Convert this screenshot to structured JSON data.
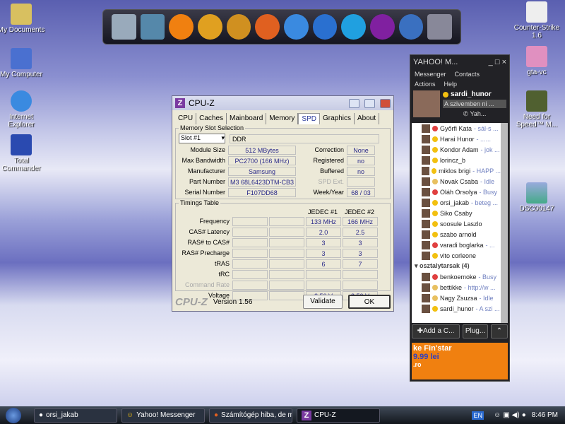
{
  "desktop": {
    "left_icons": [
      "My Documents",
      "My Computer",
      "Internet Explorer",
      "Total Commander"
    ],
    "right_icons": [
      "Counter-Strike 1.6",
      "gta-vc",
      "Need for Speed™ M...",
      "DSC00147"
    ]
  },
  "dock": {
    "icons": [
      "computer-icon",
      "network-icon",
      "winamp-icon",
      "vlc-icon",
      "winamp-bolt-icon",
      "firefox-icon",
      "internet-explorer-icon",
      "media-player-icon",
      "skype-icon",
      "yahoo-messenger-icon",
      "windows-icon",
      "recycle-bin-icon"
    ]
  },
  "cpuz": {
    "title": "CPU-Z",
    "tabs": [
      "CPU",
      "Caches",
      "Mainboard",
      "Memory",
      "SPD",
      "Graphics",
      "About"
    ],
    "active_tab": "SPD",
    "slot_group": "Memory Slot Selection",
    "slot": "Slot #1",
    "type": "DDR",
    "fields": [
      {
        "label": "Module Size",
        "value": "512 MBytes"
      },
      {
        "label": "Max Bandwidth",
        "value": "PC2700 (166 MHz)"
      },
      {
        "label": "Manufacturer",
        "value": "Samsung"
      },
      {
        "label": "Part Number",
        "value": "M3 68L6423DTM-CB3"
      },
      {
        "label": "Serial Number",
        "value": "F107DD68"
      }
    ],
    "right_fields": [
      {
        "label": "Correction",
        "value": "None"
      },
      {
        "label": "Registered",
        "value": "no"
      },
      {
        "label": "Buffered",
        "value": "no"
      },
      {
        "label": "SPD Ext.",
        "value": ""
      },
      {
        "label": "Week/Year",
        "value": "68 / 03"
      }
    ],
    "timings_group": "Timings Table",
    "col_headers": [
      "JEDEC #1",
      "JEDEC #2"
    ],
    "timings": [
      {
        "label": "Frequency",
        "j1": "133 MHz",
        "j2": "166 MHz"
      },
      {
        "label": "CAS# Latency",
        "j1": "2.0",
        "j2": "2.5"
      },
      {
        "label": "RAS# to CAS#",
        "j1": "3",
        "j2": "3"
      },
      {
        "label": "RAS# Precharge",
        "j1": "3",
        "j2": "3"
      },
      {
        "label": "tRAS",
        "j1": "6",
        "j2": "7"
      },
      {
        "label": "tRC",
        "j1": "",
        "j2": ""
      },
      {
        "label": "Command Rate",
        "j1": "",
        "j2": ""
      },
      {
        "label": "Voltage",
        "j1": "2.50 V",
        "j2": "2.50 V"
      }
    ],
    "brand": "CPU-Z",
    "version": "Version 1.56",
    "validate": "Validate",
    "ok": "OK"
  },
  "yahoo": {
    "title": "YAHOO! M...",
    "menu": [
      "Messenger",
      "Contacts",
      "Actions",
      "Help"
    ],
    "user": "sardi_hunor",
    "status": "A szivemben ni ...",
    "yah": "Yah...",
    "contacts": [
      {
        "name": "Győrfi Kata",
        "sub": " - sál-s ...",
        "s": "busy"
      },
      {
        "name": "Harai Hunor",
        "sub": " - ......",
        "s": "on"
      },
      {
        "name": "Kondor Adam",
        "sub": " - jok ...",
        "s": "on"
      },
      {
        "name": "lorincz_b",
        "sub": "",
        "s": "on"
      },
      {
        "name": "miklos brigi",
        "sub": " - HAPP ...",
        "s": "on"
      },
      {
        "name": "Novak Csaba",
        "sub": " - Idle",
        "s": "idle"
      },
      {
        "name": "Oláh Orsolya",
        "sub": " - Busy",
        "s": "busy"
      },
      {
        "name": "orsi_jakab",
        "sub": " - beteg ...",
        "s": "on"
      },
      {
        "name": "Siko Csaby",
        "sub": "",
        "s": "on"
      },
      {
        "name": "soosule Laszlo",
        "sub": "",
        "s": "on"
      },
      {
        "name": "szabo arnold",
        "sub": "",
        "s": "on"
      },
      {
        "name": "varadi boglarka",
        "sub": " - ...",
        "s": "busy"
      },
      {
        "name": "vito corleone",
        "sub": "",
        "s": "on"
      }
    ],
    "group": "osztalytarsak (4)",
    "group_contacts": [
      {
        "name": "benkoemoke",
        "sub": " - Busy",
        "s": "busy"
      },
      {
        "name": "bettikke",
        "sub": " - http://w ...",
        "s": "idle"
      },
      {
        "name": "Nagy Zsuzsa",
        "sub": " - Idle",
        "s": "idle"
      },
      {
        "name": "sardi_hunor",
        "sub": " - A szi ...",
        "s": "on"
      }
    ],
    "add_button": "Add a C...",
    "plugins_button": "Plug...",
    "ad_line1": "ke Fin'star",
    "ad_line2": "9.99 lei",
    "ad_brand": ".ro"
  },
  "taskbar": {
    "items": [
      "orsi_jakab",
      "Yahoo! Messenger",
      "Számítógép hiba, de m...",
      "CPU-Z"
    ],
    "lang": "EN",
    "clock": "8:46 PM"
  }
}
